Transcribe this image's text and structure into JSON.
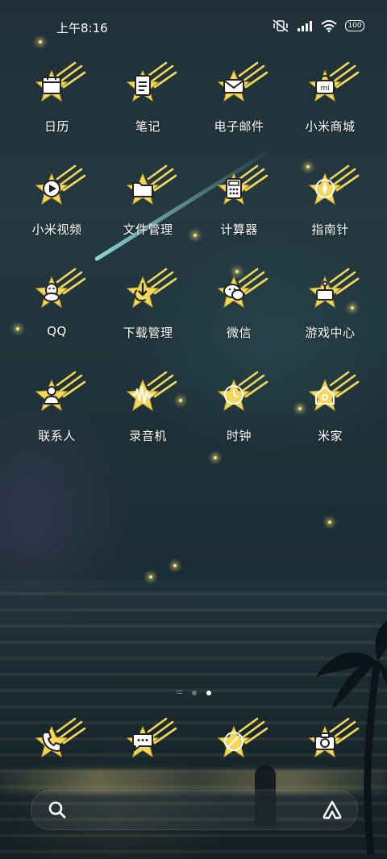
{
  "status_bar": {
    "time": "上午8:16",
    "battery": "100",
    "icons": [
      "mute-vibrate-icon",
      "signal-icon",
      "wifi-icon",
      "battery-icon"
    ]
  },
  "apps": [
    {
      "label": "日历",
      "icon": "calendar-icon"
    },
    {
      "label": "笔记",
      "icon": "notes-icon"
    },
    {
      "label": "电子邮件",
      "icon": "email-icon"
    },
    {
      "label": "小米商城",
      "icon": "mi-store-icon"
    },
    {
      "label": "小米视频",
      "icon": "video-icon"
    },
    {
      "label": "文件管理",
      "icon": "folder-icon"
    },
    {
      "label": "计算器",
      "icon": "calculator-icon"
    },
    {
      "label": "指南针",
      "icon": "compass-icon"
    },
    {
      "label": "QQ",
      "icon": "qq-icon"
    },
    {
      "label": "下载管理",
      "icon": "download-icon"
    },
    {
      "label": "微信",
      "icon": "wechat-icon"
    },
    {
      "label": "游戏中心",
      "icon": "game-center-icon"
    },
    {
      "label": "联系人",
      "icon": "contacts-icon"
    },
    {
      "label": "录音机",
      "icon": "recorder-icon"
    },
    {
      "label": "时钟",
      "icon": "clock-icon"
    },
    {
      "label": "米家",
      "icon": "mijia-icon"
    }
  ],
  "pager": {
    "pages": 2,
    "active": 2
  },
  "dock": [
    {
      "icon": "phone-icon"
    },
    {
      "icon": "messages-icon"
    },
    {
      "icon": "browser-icon"
    },
    {
      "icon": "camera-icon"
    }
  ],
  "search": {
    "icons": [
      "search-icon",
      "assistant-icon"
    ]
  },
  "colors": {
    "star": "#f5d85a",
    "background": "#1f3038"
  }
}
